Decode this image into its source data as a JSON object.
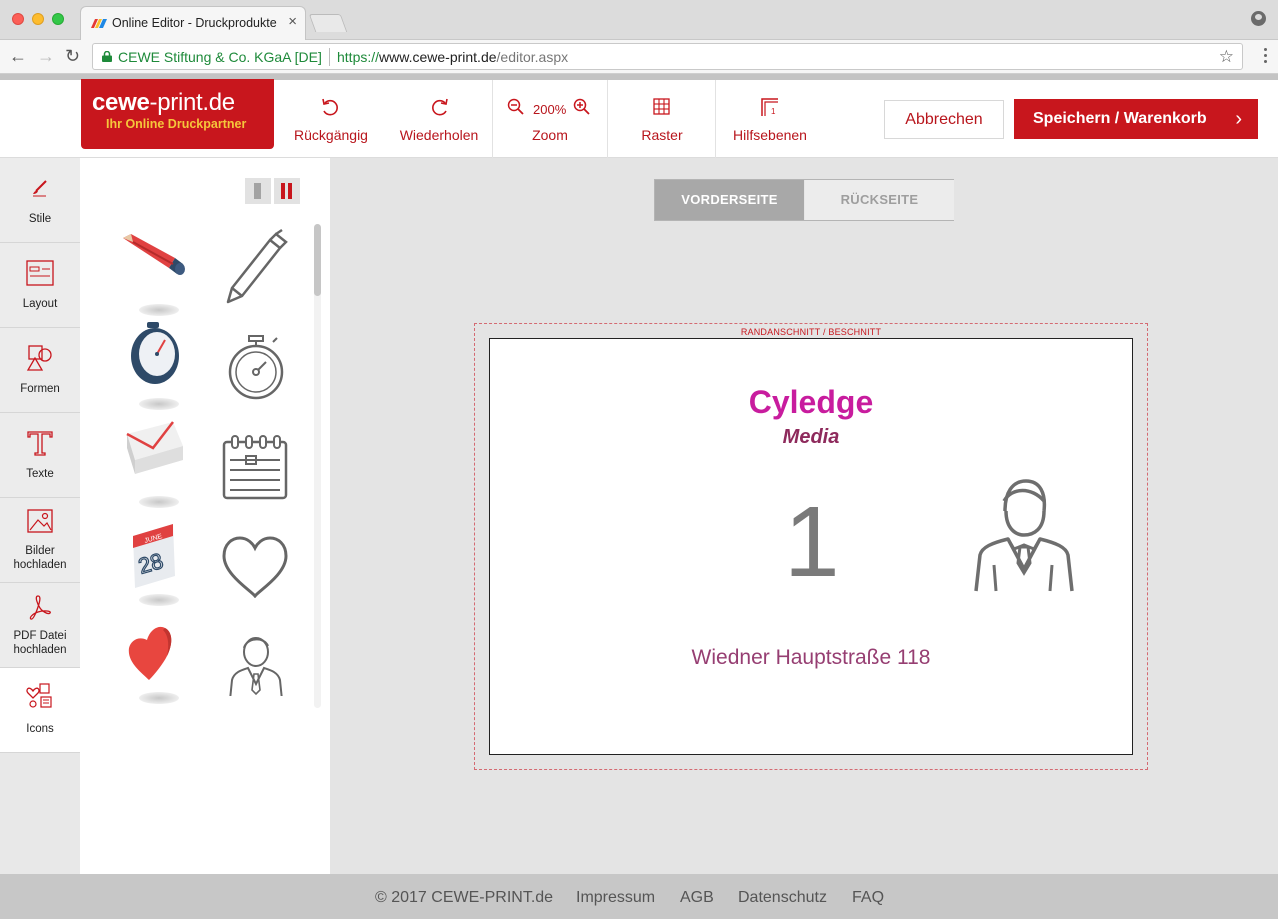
{
  "browser": {
    "tab_title": "Online Editor - Druckprodukte",
    "tab_close": "×",
    "site_identity": "CEWE Stiftung & Co. KGaA [DE]",
    "url_scheme": "https://",
    "url_host": "www.cewe-print.de",
    "url_path": "/editor.aspx",
    "back_icon": "←",
    "forward_icon": "→",
    "reload_icon": "↻",
    "star_icon": "☆"
  },
  "header": {
    "logo_main_bold": "cewe",
    "logo_main_rest": "-print.de",
    "logo_tagline": "Ihr Online Druckpartner",
    "undo_label": "Rückgängig",
    "redo_label": "Wiederholen",
    "zoom_value": "200%",
    "zoom_label": "Zoom",
    "grid_label": "Raster",
    "guides_label": "Hilfsebenen",
    "cancel_label": "Abbrechen",
    "save_label": "Speichern / Warenkorb",
    "save_chevron": "›"
  },
  "sidebar": {
    "items": [
      {
        "label": "Stile",
        "icon": "brush-icon"
      },
      {
        "label": "Layout",
        "icon": "layout-icon"
      },
      {
        "label": "Formen",
        "icon": "shapes-icon"
      },
      {
        "label": "Texte",
        "icon": "text-icon"
      },
      {
        "label": "Bilder hochladen",
        "icon": "image-upload-icon"
      },
      {
        "label": "PDF Datei hochladen",
        "icon": "pdf-icon"
      },
      {
        "label": "Icons",
        "icon": "icons-icon"
      }
    ],
    "active": "Icons"
  },
  "icon_panel": {
    "icons": [
      "pencil-color-icon",
      "pen-outline-icon",
      "stopwatch-color-icon",
      "stopwatch-outline-icon",
      "envelope-color-icon",
      "calendar-outline-icon",
      "calendar-color-icon",
      "heart-outline-icon",
      "heart-color-icon",
      "businessman-outline-icon"
    ],
    "calendar_month": "JUNE",
    "calendar_day": "28"
  },
  "canvas": {
    "front_label": "VORDERSEITE",
    "back_label": "RÜCKSEITE",
    "active_side": "VORDERSEITE",
    "bleed_label": "RANDANSCHNITT / BESCHNITT",
    "card_title": "Cyledge",
    "card_subtitle": "Media",
    "card_number": "1",
    "card_address": "Wiedner Hauptstraße 118",
    "title_color": "#c81c9e"
  },
  "footer": {
    "copyright": "© 2017 CEWE-PRINT.de",
    "links": [
      "Impressum",
      "AGB",
      "Datenschutz",
      "FAQ"
    ]
  },
  "colors": {
    "brand_red": "#c8161d",
    "logo_tagline": "#f5c63b"
  }
}
